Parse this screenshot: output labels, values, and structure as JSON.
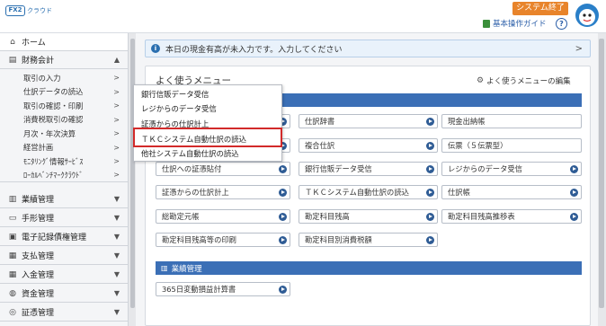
{
  "header": {
    "logo_box": "FX2",
    "logo_text": "クラウド",
    "system_end": "システム終了",
    "guide": "基本操作ガイド",
    "help": "?"
  },
  "sidebar": {
    "home": "ホーム",
    "zaimu": "財務会計",
    "sub_items": [
      "取引の入力",
      "仕訳データの読込",
      "取引の確認・印刷",
      "消費税取引の確認",
      "月次・年次決算",
      "経営計画",
      "ﾓﾆﾀﾘﾝｸﾞ情報ｻｰﾋﾞｽ",
      "ﾛｰｶﾙﾍﾞﾝﾁﾏｰｸｸﾗｳﾄﾞ"
    ],
    "sections": [
      "業績管理",
      "手形管理",
      "電子記録債権管理",
      "支払管理",
      "入金管理",
      "資金管理",
      "証憑管理"
    ]
  },
  "notice": "本日の現金有高が未入力です。入力してください",
  "panel": {
    "title": "よく使うメニュー",
    "edit": "よく使うメニューの編集",
    "section2": "業績管理"
  },
  "menu_buttons": [
    "仕訳辞書",
    "現金出納帳",
    "複合仕訳",
    "伝票（５伝票型）",
    "仕訳への証憑貼付",
    "銀行信販データ受信",
    "レジからのデータ受信",
    "証憑からの仕訳計上",
    "ＴＫＣシステム自動仕訳の読込",
    "仕訳帳",
    "総勘定元帳",
    "勘定科目残高",
    "勘定科目残高推移表",
    "勘定科目残高等の印刷",
    "勘定科目別消費税額"
  ],
  "section2_buttons": [
    "365日変動損益計算書"
  ],
  "dropdown": [
    "銀行信販データ受信",
    "レジからのデータ受信",
    "証憑からの仕訳計上",
    "ＴＫＣシステム自動仕訳の読込",
    "他社システム自動仕訳の読込"
  ],
  "colors": {
    "accent": "#3b6fb6",
    "system_end": "#e8842b",
    "highlight": "#d22a2a"
  }
}
